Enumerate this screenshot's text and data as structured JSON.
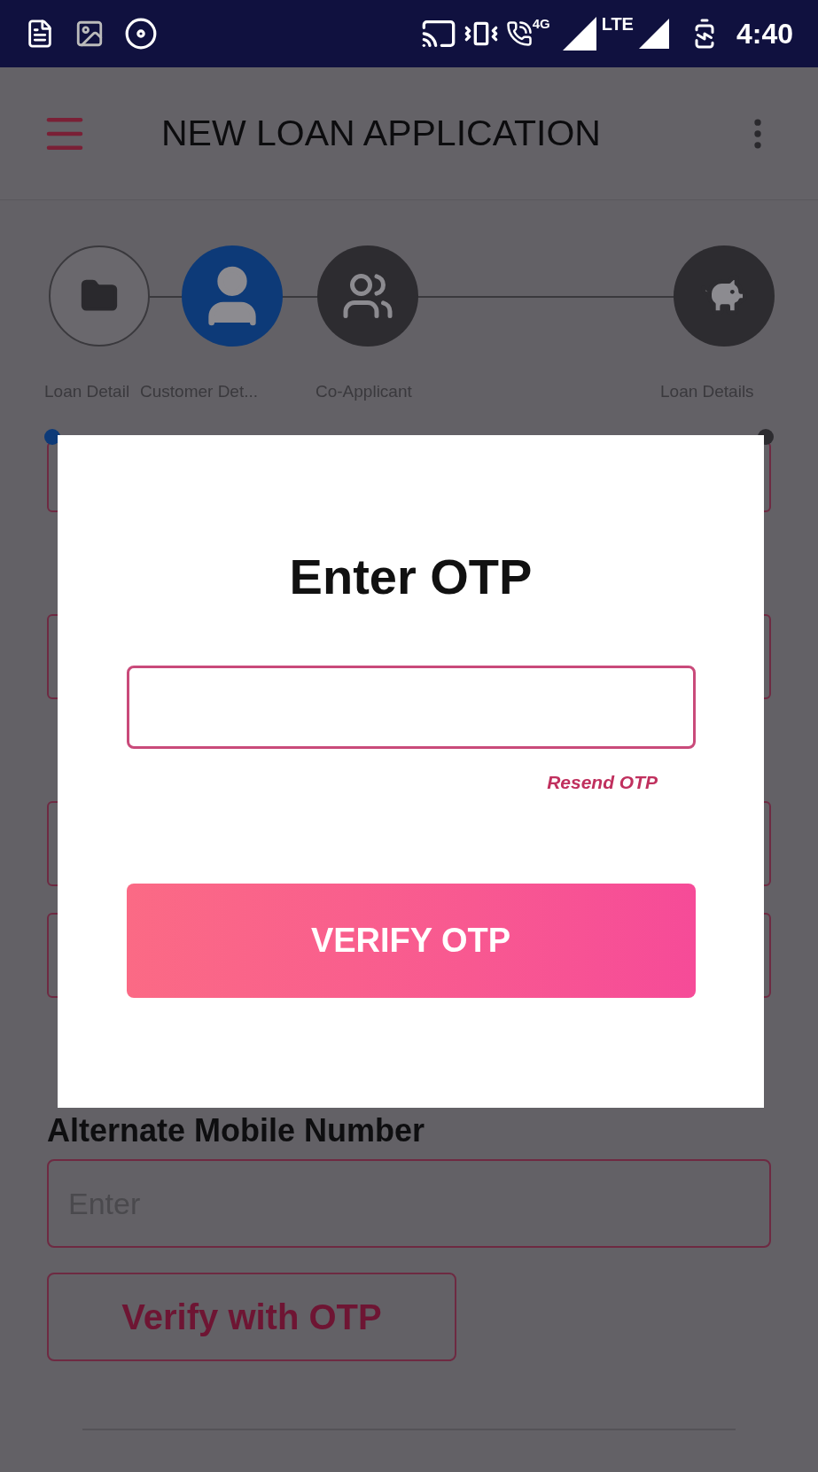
{
  "status_bar": {
    "network_4g": "4G",
    "network_lte": "LTE",
    "time": "4:40"
  },
  "header": {
    "title": "NEW LOAN APPLICATION"
  },
  "stepper": [
    {
      "label": "Loan Detail",
      "completed": true,
      "selected": false
    },
    {
      "label": "Customer Det...",
      "completed": false,
      "selected": true
    },
    {
      "label": "Co-Applicant",
      "completed": false,
      "selected": false
    },
    {
      "label": "Loan Details",
      "completed": false,
      "selected": false
    }
  ],
  "form": {
    "alternate_mobile": {
      "label": "Alternate Mobile Number",
      "placeholder": "Enter"
    },
    "verify_button": "Verify with OTP"
  },
  "dialog": {
    "title": "Enter OTP",
    "resend_link": "Resend OTP",
    "verify_button": "VERIFY OTP"
  }
}
